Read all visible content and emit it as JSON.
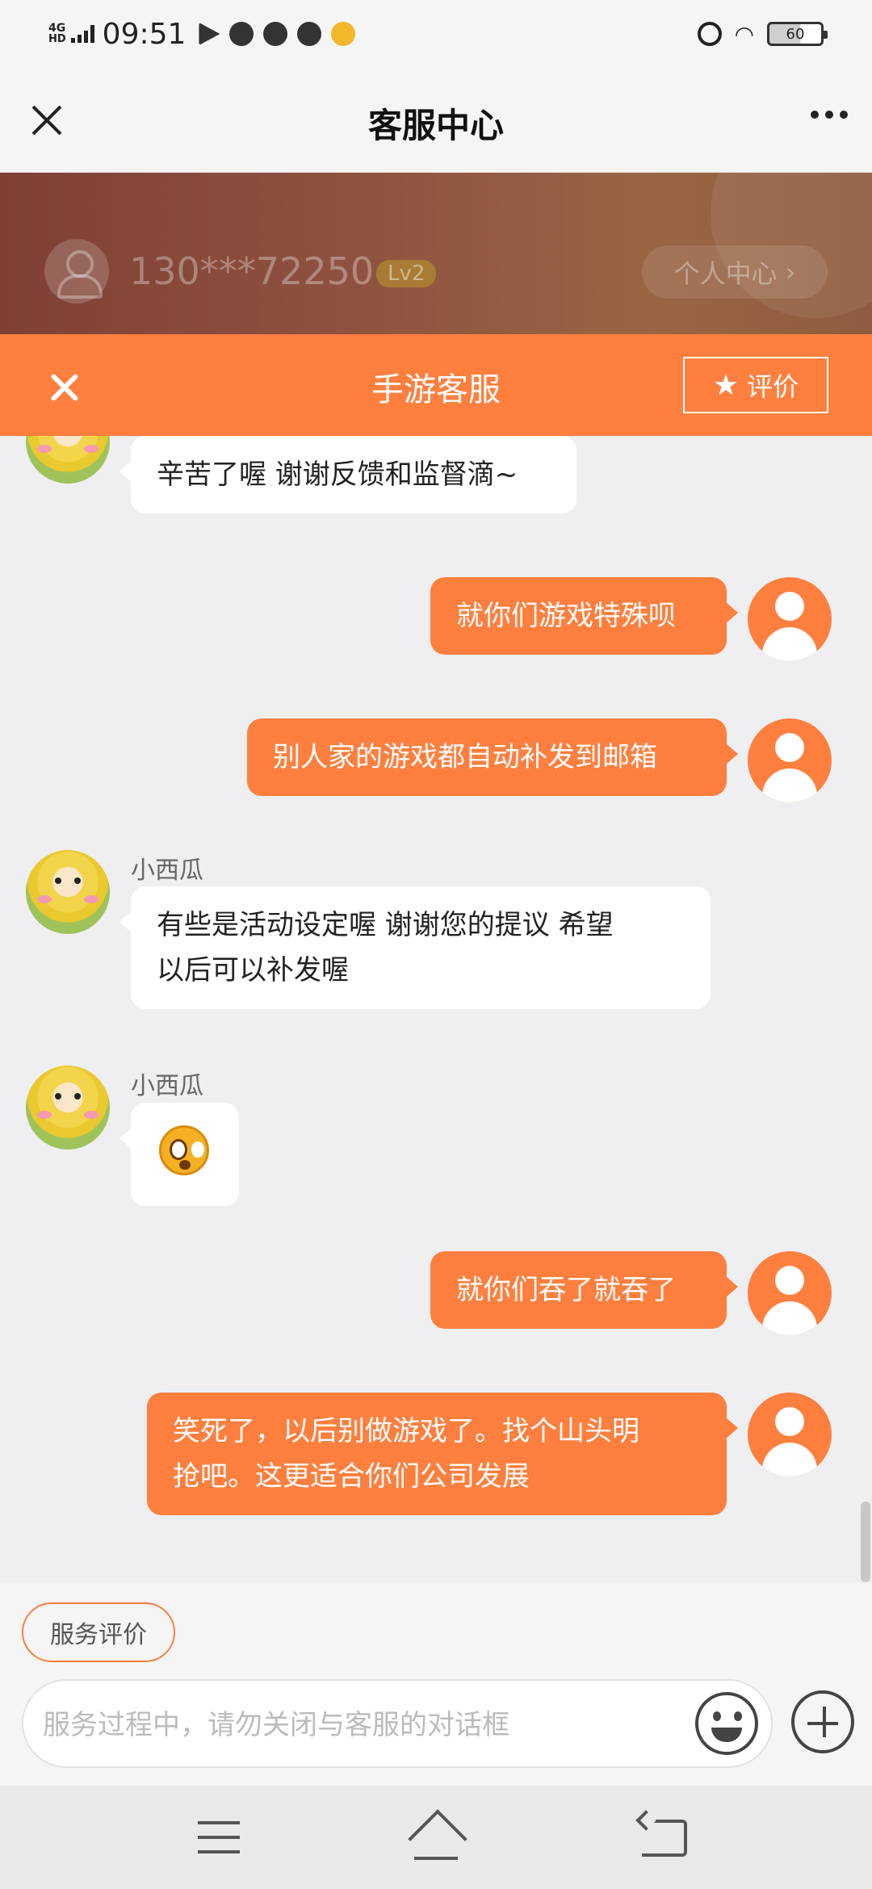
{
  "status_bar": {
    "network": "4G",
    "network_sub": "HD",
    "time": "09:51",
    "battery": "60"
  },
  "header": {
    "title": "客服中心"
  },
  "user_banner": {
    "phone": "130***72250",
    "level": "Lv2",
    "personal_center": "个人中心",
    "chevron": "›"
  },
  "cs_bar": {
    "title": "手游客服",
    "rate_label": "评价",
    "star": "★"
  },
  "messages": [
    {
      "side": "left",
      "name": "",
      "text": "辛苦了喔 谢谢反馈和监督滴~"
    },
    {
      "side": "right",
      "text": "就你们游戏特殊呗"
    },
    {
      "side": "right",
      "text": "别人家的游戏都自动补发到邮箱"
    },
    {
      "side": "left",
      "name": "小西瓜",
      "line1": "有些是活动设定喔 谢谢您的提议 希望",
      "line2": "以后可以补发喔"
    },
    {
      "side": "left",
      "name": "小西瓜",
      "emoji": "surprised-face"
    },
    {
      "side": "right",
      "text": "就你们吞了就吞了"
    },
    {
      "side": "right",
      "line1": "笑死了，以后别做游戏了。找个山头明",
      "line2": "抢吧。这更适合你们公司发展"
    }
  ],
  "bottom": {
    "service_rating": "服务评价",
    "input_placeholder": "服务过程中，请勿关闭与客服的对话框",
    "input_value": ""
  },
  "colors": {
    "accent": "#ff7f3f",
    "banner": "#8e5240",
    "background": "#efeff2"
  }
}
